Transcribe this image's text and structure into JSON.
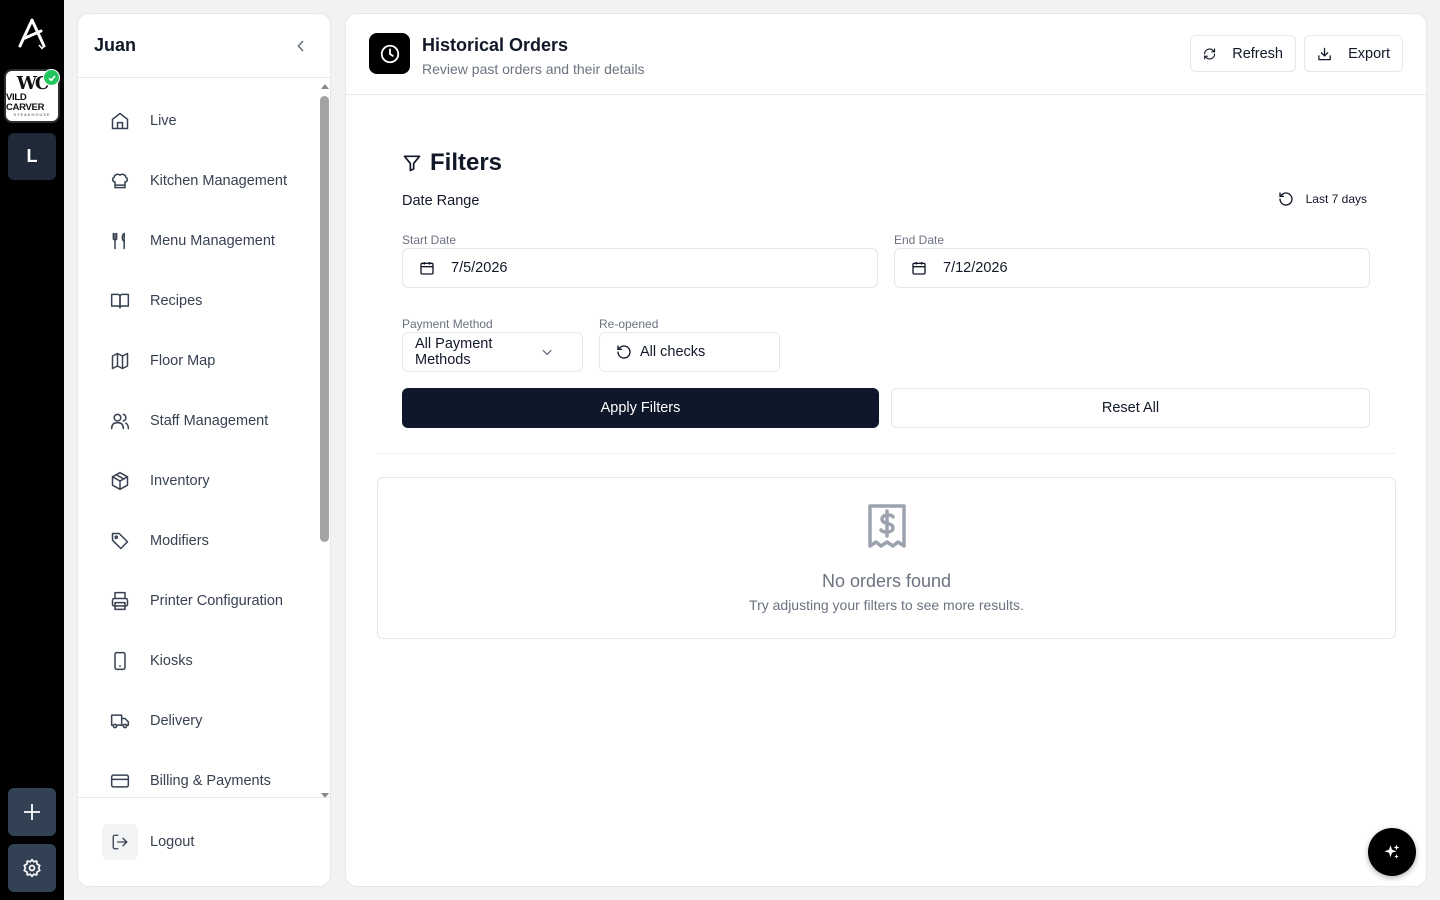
{
  "rail": {
    "brand_monogram": "WC",
    "brand_wordmark": "VILD CARVER",
    "brand_tagline": "STEAKHOUSE",
    "location_initial": "L"
  },
  "sidebar": {
    "user_name": "Juan",
    "items": [
      {
        "label": "Live",
        "icon": "home-icon"
      },
      {
        "label": "Kitchen Management",
        "icon": "chef-hat-icon"
      },
      {
        "label": "Menu Management",
        "icon": "utensils-icon"
      },
      {
        "label": "Recipes",
        "icon": "book-icon"
      },
      {
        "label": "Floor Map",
        "icon": "map-icon"
      },
      {
        "label": "Staff Management",
        "icon": "users-icon"
      },
      {
        "label": "Inventory",
        "icon": "package-icon"
      },
      {
        "label": "Modifiers",
        "icon": "tag-icon"
      },
      {
        "label": "Printer Configuration",
        "icon": "printer-icon"
      },
      {
        "label": "Kiosks",
        "icon": "tablet-icon"
      },
      {
        "label": "Delivery",
        "icon": "truck-icon"
      },
      {
        "label": "Billing & Payments",
        "icon": "credit-card-icon"
      }
    ],
    "logout_label": "Logout"
  },
  "header": {
    "title": "Historical Orders",
    "subtitle": "Review past orders and their details",
    "refresh_label": "Refresh",
    "export_label": "Export"
  },
  "filters": {
    "title": "Filters",
    "date_range_label": "Date Range",
    "preset_label": "Last 7 days",
    "start_date_label": "Start Date",
    "start_date_value": "7/5/2026",
    "end_date_label": "End Date",
    "end_date_value": "7/12/2026",
    "payment_method_label": "Payment Method",
    "payment_method_value": "All Payment Methods",
    "reopened_label": "Re-opened",
    "reopened_value": "All checks",
    "apply_label": "Apply Filters",
    "reset_label": "Reset All"
  },
  "empty_state": {
    "title": "No orders found",
    "subtitle": "Try adjusting your filters to see more results."
  },
  "colors": {
    "primary": "#0f172a",
    "success": "#22c55e",
    "rail_bg": "#000000",
    "page_bg": "#f1f2f4"
  }
}
